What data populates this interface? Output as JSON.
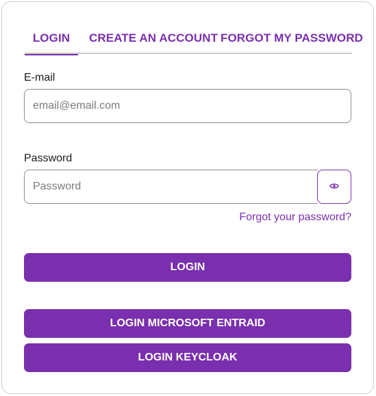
{
  "tabs": [
    {
      "label": "LOGIN",
      "active": true
    },
    {
      "label": "CREATE AN ACCOUNT",
      "active": false
    },
    {
      "label": "FORGOT MY PASSWORD",
      "active": false
    }
  ],
  "email": {
    "label": "E-mail",
    "placeholder": "email@email.com",
    "value": ""
  },
  "password": {
    "label": "Password",
    "placeholder": "Password",
    "value": "",
    "toggle_icon": "eye-icon"
  },
  "forgot_link": "Forgot your password?",
  "buttons": {
    "login": "LOGIN",
    "microsoft": "LOGIN MICROSOFT ENTRAID",
    "keycloak": "LOGIN KEYCLOAK"
  },
  "colors": {
    "accent": "#7a2fae",
    "border": "#8a8a8a",
    "tab_underline": "#c8c8c8"
  }
}
